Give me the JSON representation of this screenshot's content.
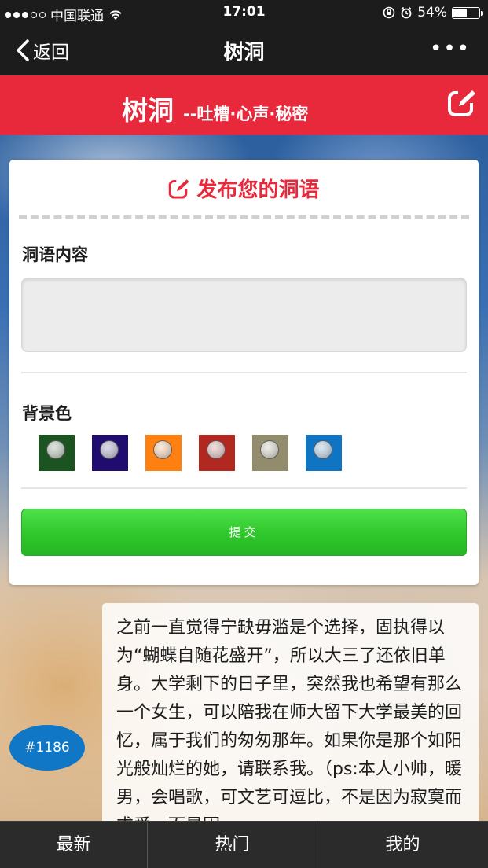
{
  "status_bar": {
    "carrier": "中国联通",
    "time": "17:01",
    "battery": "54%",
    "battery_level": 0.54
  },
  "nav": {
    "back_label": "返回",
    "title": "树洞",
    "more_label": "•••"
  },
  "header": {
    "title": "树洞",
    "subtitle": "--吐槽·心声·秘密",
    "accent_color": "#e8283b"
  },
  "form": {
    "heading": "发布您的洞语",
    "content_label": "洞语内容",
    "content_value": "",
    "bg_label": "背景色",
    "colors": [
      "#1c5421",
      "#1f0c6e",
      "#ff7f10",
      "#b12821",
      "#928c6d",
      "#0f75c2"
    ],
    "submit_label": "提交"
  },
  "post": {
    "id": "#1186",
    "text": "之前一直觉得宁缺毋滥是个选择，固执得以为“蝴蝶自随花盛开”，所以大三了还依旧单身。大学剩下的日子里，突然我也希望有那么一个女生，可以陪我在师大留下大学最美的回忆，属于我们的匆匆那年。如果你是那个如阳光般灿烂的她，请联系我。（ps:本人小帅，暖男，会唱歌，可文艺可逗比，不是因为寂寞而求爱，而是因"
  },
  "tabs": [
    "最新",
    "热门",
    "我的"
  ]
}
